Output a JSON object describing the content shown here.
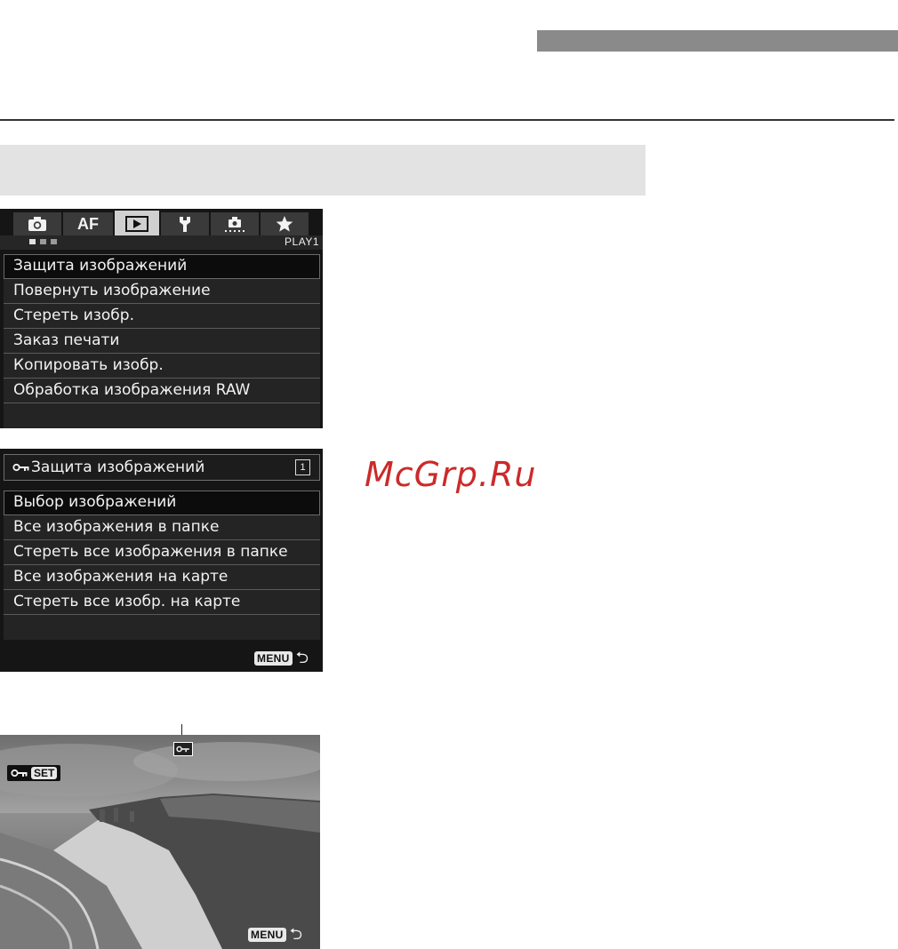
{
  "menu1": {
    "tabs": [
      {
        "icon": "camera-icon"
      },
      {
        "label": "AF"
      },
      {
        "icon": "play-icon"
      },
      {
        "icon": "wrench-icon"
      },
      {
        "icon": "custom-functions-icon"
      },
      {
        "icon": "star-icon"
      }
    ],
    "active_tab": 2,
    "page_label": "PLAY1",
    "items": [
      "Защита изображений",
      "Повернуть изображение",
      "Стереть изобр.",
      "Заказ печати",
      "Копировать изобр.",
      "Обработка изображения RAW"
    ],
    "selected_index": 0
  },
  "menu2": {
    "title": "Защита изображений",
    "title_icon": "key-icon",
    "card_label": "1",
    "items": [
      "Выбор изображений",
      "Все изображения в папке",
      "Стереть все изображения в папке",
      "Все изображения на карте",
      "Стереть все изобр. на карте"
    ],
    "selected_index": 0,
    "menu_button": "MENU"
  },
  "photo": {
    "set_label": "SET",
    "menu_button": "MENU"
  },
  "watermark": "McGrp.Ru",
  "colors": {
    "screen_bg": "#151515",
    "menu_item_bg": "#242424",
    "watermark": "#cc2a2a",
    "top_bar": "#8a8a8a",
    "grey_band": "#e3e3e3"
  }
}
